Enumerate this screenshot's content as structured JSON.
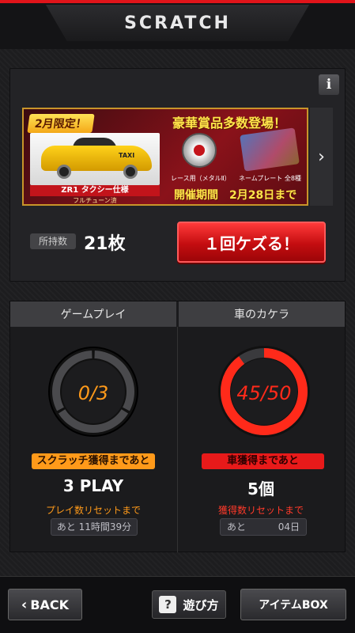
{
  "header": {
    "title": "SCRATCH"
  },
  "top_card": {
    "info_label": "i",
    "banner": {
      "tag": "2月限定！",
      "headline": "豪華賞品多数登場！",
      "car_name": "ZR1 タクシー仕様",
      "car_sub": "フルチューン済",
      "taxi_text": "TAXI",
      "prize1_caption": "レース用（メタルⅡ）",
      "prize2_caption": "ネームプレート 全8種",
      "period": "開催期間　2月28日まで"
    },
    "next_icon": "chevron-right-icon",
    "owned_label": "所持数",
    "owned_value": "21枚",
    "scratch_button": "１回ケズる！"
  },
  "panels": {
    "left": {
      "header": "ゲームプレイ",
      "gauge_text": "0/3",
      "current": 0,
      "max": 3,
      "badge": "スクラッチ獲得まであと",
      "big_value": "3 PLAY",
      "reset_label": "プレイ数リセットまで",
      "reset_value": "あと 11時間39分",
      "accent": "#ff9a1a"
    },
    "right": {
      "header": "車のカケラ",
      "gauge_text": "45/50",
      "current": 45,
      "max": 50,
      "badge": "車獲得まであと",
      "big_value": "5個",
      "reset_label": "獲得数リセットまで",
      "reset_prefix": "あと",
      "reset_value": "04日",
      "accent": "#ff2a1a"
    }
  },
  "bottom": {
    "back_label": "BACK",
    "howto_icon": "question-icon",
    "howto_label": "遊び方",
    "itembox_label": "アイテムBOX"
  }
}
